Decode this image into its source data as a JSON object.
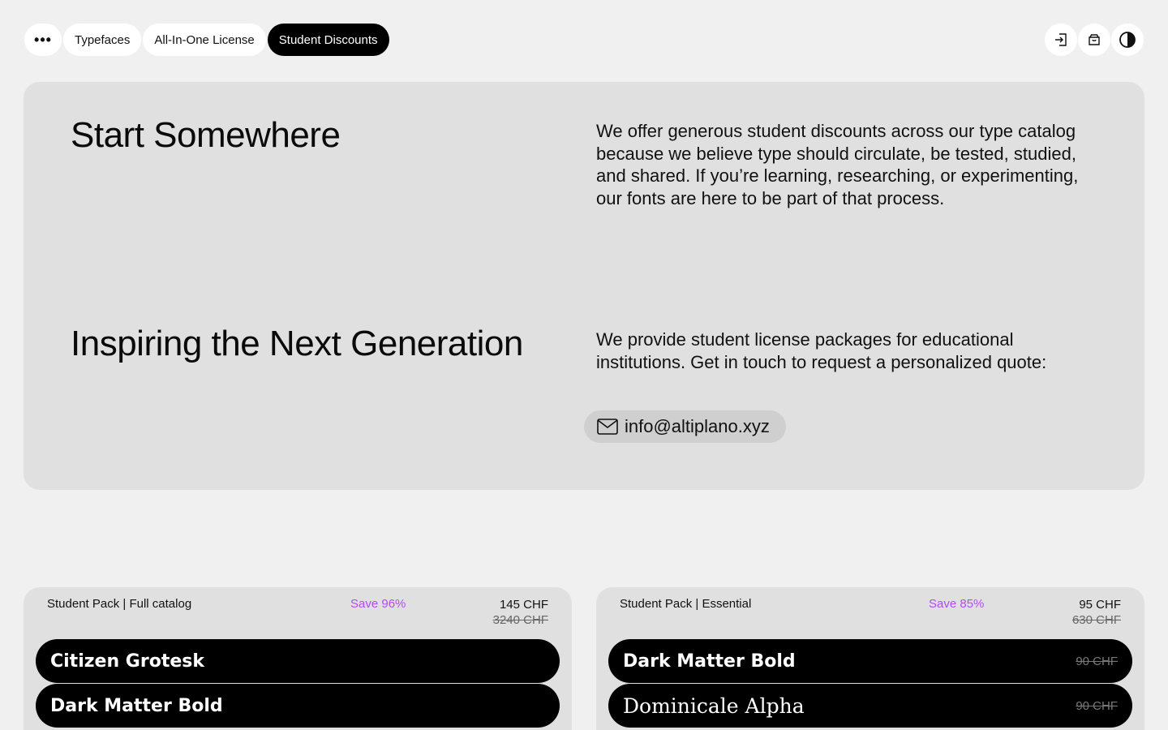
{
  "nav": {
    "items": [
      "Typefaces",
      "All-In-One License",
      "Student Discounts"
    ],
    "active_index": 2,
    "more_icon": "more-dots-icon"
  },
  "toolbar": {
    "icons": [
      "login-icon",
      "cart-icon",
      "contrast-icon"
    ]
  },
  "hero": {
    "section1_title": "Start Somewhere",
    "section1_text": "We offer generous student discounts across our type catalog because we believe type should circulate, be tested, studied, and shared. If you’re learning, researching, or experimenting, our fonts are here to be part of that process.",
    "section2_title": "Inspiring the Next Generation",
    "section2_text": "We provide student license packages for educational institutions. Get in touch to request a personalized quote:",
    "email": "info@altiplano.xyz",
    "email_icon": "mail-icon"
  },
  "packs": [
    {
      "name": "Student Pack | Full catalog",
      "save": "Save 96%",
      "price": "145 CHF",
      "old_price": "3240 CHF",
      "fonts": [
        {
          "name": "Citizen Grotesk",
          "price": ""
        },
        {
          "name": "Dark Matter Bold",
          "price": ""
        }
      ]
    },
    {
      "name": "Student Pack | Essential",
      "save": "Save 85%",
      "price": "95 CHF",
      "old_price": "630 CHF",
      "fonts": [
        {
          "name": "Dark Matter Bold",
          "price": "90 CHF"
        },
        {
          "name": "Dominicale Alpha",
          "price": "90 CHF"
        }
      ]
    }
  ],
  "colors": {
    "background": "#f0f0f0",
    "panel": "#e0e0e0",
    "accent_save": "#b14bf4",
    "active_pill": "#000000"
  }
}
